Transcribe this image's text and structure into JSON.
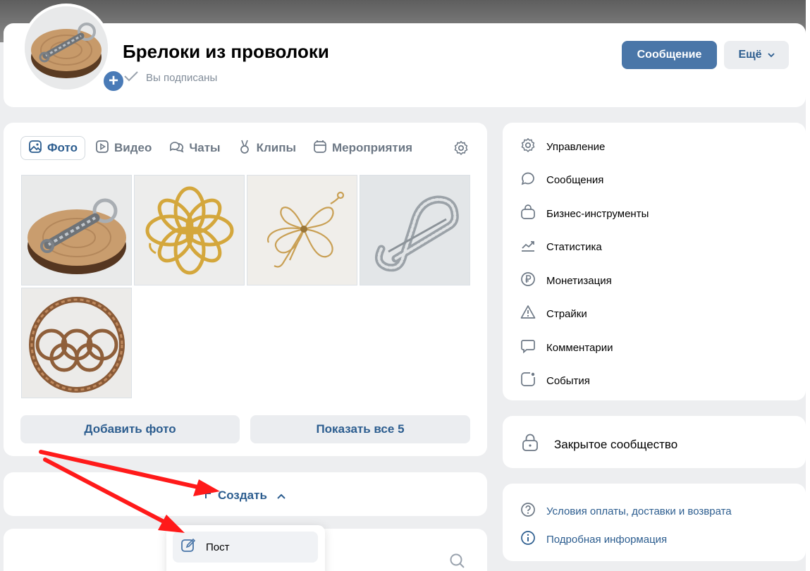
{
  "header": {
    "title": "Брелоки из проволоки",
    "subscription_status": "Вы подписаны",
    "message_button": "Сообщение",
    "more_button": "Ещё"
  },
  "media": {
    "tabs": [
      {
        "label": "Фото",
        "icon": "image-icon",
        "active": true
      },
      {
        "label": "Видео",
        "icon": "video-icon",
        "active": false
      },
      {
        "label": "Чаты",
        "icon": "chats-icon",
        "active": false
      },
      {
        "label": "Клипы",
        "icon": "clips-icon",
        "active": false
      },
      {
        "label": "Мероприятия",
        "icon": "calendar-icon",
        "active": false
      }
    ],
    "photos": [
      "keychain-on-wood",
      "gold-wire-flower",
      "gold-filigree-flower",
      "silver-pin-brooch",
      "copper-olympic-rings"
    ],
    "add_photo_button": "Добавить фото",
    "show_all_button": "Показать все 5"
  },
  "create": {
    "label": "Создать",
    "menu_items": [
      {
        "label": "Пост",
        "icon": "edit-icon"
      }
    ]
  },
  "management_menu": [
    {
      "label": "Управление",
      "icon": "gear-icon"
    },
    {
      "label": "Сообщения",
      "icon": "message-icon"
    },
    {
      "label": "Бизнес-инструменты",
      "icon": "bag-icon"
    },
    {
      "label": "Статистика",
      "icon": "trend-icon"
    },
    {
      "label": "Монетизация",
      "icon": "ruble-icon"
    },
    {
      "label": "Страйки",
      "icon": "warning-icon"
    },
    {
      "label": "Комментарии",
      "icon": "comment-icon"
    },
    {
      "label": "События",
      "icon": "event-icon"
    }
  ],
  "community_type": "Закрытое сообщество",
  "info_links": [
    {
      "label": "Условия оплаты, доставки и возврата",
      "icon": "question-icon"
    },
    {
      "label": "Подробная информация",
      "icon": "info-icon"
    }
  ],
  "colors": {
    "accent": "#4a76a8",
    "link": "#2c5d8f",
    "secondary_text": "#818c99",
    "page_bg": "#edeef0",
    "annotation_arrow": "#ff1a1a"
  }
}
